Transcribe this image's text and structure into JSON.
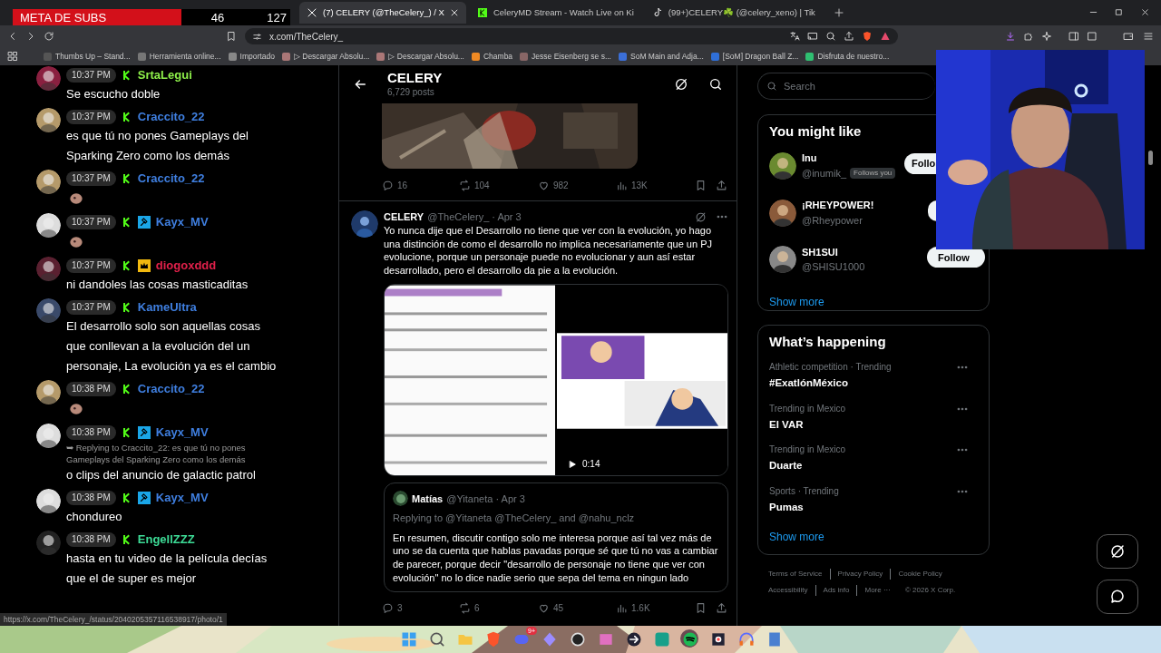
{
  "sub_goal": {
    "label": "META DE SUBS",
    "current": "46",
    "target": "127"
  },
  "browser": {
    "tabs": [
      {
        "title": "(7) CELERY (@TheCelery_) / X",
        "kind": "x",
        "selected": true
      },
      {
        "title": "CeleryMD Stream - Watch Live on Ki",
        "kind": "kick",
        "selected": false
      },
      {
        "title": "(99+)CELERY☘️ (@celery_xeno) | Tik",
        "kind": "tiktok",
        "selected": false
      }
    ],
    "address": "x.com/TheCelery_",
    "bookmarks": [
      "Thumbs Up – Stand...",
      "Herramienta online...",
      "Importado",
      "▷ Descargar Absolu...",
      "▷ Descargar Absolu...",
      "Chamba",
      "Jesse Eisenberg se s...",
      "SoM Main and Adja...",
      "[SoM] Dragon Ball Z...",
      "Disfruta de nuestro..."
    ],
    "status_url": "https://x.com/TheCelery_/status/2040205357116538917/photo/1"
  },
  "chat": {
    "messages": [
      {
        "time": "10:37 PM",
        "badges": [
          {
            "kind": "kick"
          }
        ],
        "user": "SrtaLegui",
        "color": "#8ef04a",
        "kind": "text",
        "text": "Se escucho doble"
      },
      {
        "time": "10:37 PM",
        "badges": [
          {
            "kind": "kick"
          }
        ],
        "user": "Craccito_22",
        "color": "#3f7fe0",
        "kind": "text",
        "text": "es que tú no pones Gameplays del Sparking Zero como los demás"
      },
      {
        "time": "10:37 PM",
        "badges": [
          {
            "kind": "kick"
          }
        ],
        "user": "Craccito_22",
        "color": "#3f7fe0",
        "kind": "emote"
      },
      {
        "time": "10:37 PM",
        "badges": [
          {
            "kind": "kick"
          },
          {
            "kind": "mod"
          }
        ],
        "user": "Kayx_MV",
        "color": "#3f7fe0",
        "kind": "emote"
      },
      {
        "time": "10:37 PM",
        "badges": [
          {
            "kind": "kick"
          },
          {
            "kind": "crown"
          }
        ],
        "user": "diogoxddd",
        "color": "#e0204a",
        "kind": "text",
        "text": "ni dandoles las cosas masticaditas"
      },
      {
        "time": "10:37 PM",
        "badges": [
          {
            "kind": "kick"
          }
        ],
        "user": "KameUltra",
        "color": "#3f7fe0",
        "kind": "text",
        "text": "El desarrollo solo son aquellas cosas que conllevan a la evolución del un personaje, La evolución ya es el cambio"
      },
      {
        "time": "10:38 PM",
        "badges": [
          {
            "kind": "kick"
          }
        ],
        "user": "Craccito_22",
        "color": "#3f7fe0",
        "kind": "emote"
      },
      {
        "time": "10:38 PM",
        "badges": [
          {
            "kind": "kick"
          },
          {
            "kind": "mod"
          }
        ],
        "user": "Kayx_MV",
        "color": "#3f7fe0",
        "kind": "text",
        "reply": "➥ Replying to Craccito_22: es que tú no pones Gameplays del Sparking Zero como los demás",
        "text": "o clips del anuncio de galactic patrol"
      },
      {
        "time": "10:38 PM",
        "badges": [
          {
            "kind": "kick"
          },
          {
            "kind": "mod"
          }
        ],
        "user": "Kayx_MV",
        "color": "#3f7fe0",
        "kind": "text",
        "text": "chondureo"
      },
      {
        "time": "10:38 PM",
        "badges": [
          {
            "kind": "kick"
          }
        ],
        "user": "EngellZZZ",
        "color": "#3ddc97",
        "kind": "text",
        "text": "hasta en tu video de la película decías que el de super es mejor"
      }
    ]
  },
  "profile_header": {
    "name": "CELERY",
    "posts": "6,729 posts"
  },
  "tweets": [
    {
      "stats": {
        "replies": "16",
        "reposts": "104",
        "likes": "982",
        "views": "13K"
      }
    },
    {
      "name": "CELERY",
      "handle": "@TheCelery_ · Apr 3",
      "text": "Yo nunca dije que el Desarrollo no tiene que ver con la evolución, yo hago una distinción de como el desarrollo no implica necesariamente que un PJ evolucione, porque un personaje puede no evolucionar y aun así estar desarrollado, pero el desarrollo da pie a la evolución.",
      "video_duration": "0:14",
      "quote": {
        "name": "Matías",
        "handle": "@Yitaneta · Apr 3",
        "replying": "Replying to @Yitaneta @TheCelery_ and @nahu_nclz",
        "text": "En resumen, discutir contigo solo me interesa porque así tal vez más de uno se da cuenta que hablas pavadas porque sé que tú no vas a cambiar de parecer, porque decir \"desarrollo de personaje no tiene que ver con evolución\" no lo dice nadie serio que sepa del tema en ningun lado"
      },
      "stats": {
        "replies": "3",
        "reposts": "6",
        "likes": "45",
        "views": "1.6K"
      }
    }
  ],
  "right": {
    "search_placeholder": "Search",
    "might_like": {
      "title": "You might like",
      "accounts": [
        {
          "name": "Inu",
          "handle": "@inumik_",
          "follows_label": "Follows you",
          "button": "Follo"
        },
        {
          "name": "¡RHEYPOWER!",
          "handle": "@Rheypower"
        },
        {
          "name": "SH1SUI",
          "handle": "@SHISU1000",
          "button": "Follow"
        }
      ],
      "show_more": "Show more"
    },
    "happening": {
      "title": "What’s happening",
      "trends": [
        {
          "context": "Athletic competition · Trending",
          "topic": "#ExatlónMéxico"
        },
        {
          "context": "Trending in Mexico",
          "topic": "El VAR"
        },
        {
          "context": "Trending in Mexico",
          "topic": "Duarte"
        },
        {
          "context": "Sports · Trending",
          "topic": "Pumas"
        }
      ],
      "show_more": "Show more"
    },
    "footer": [
      "Terms of Service",
      "Privacy Policy",
      "Cookie Policy",
      "Accessibility",
      "Ads info",
      "More ···",
      "© 2026 X Corp."
    ]
  },
  "taskbar": {
    "discord_badge": "9+"
  }
}
